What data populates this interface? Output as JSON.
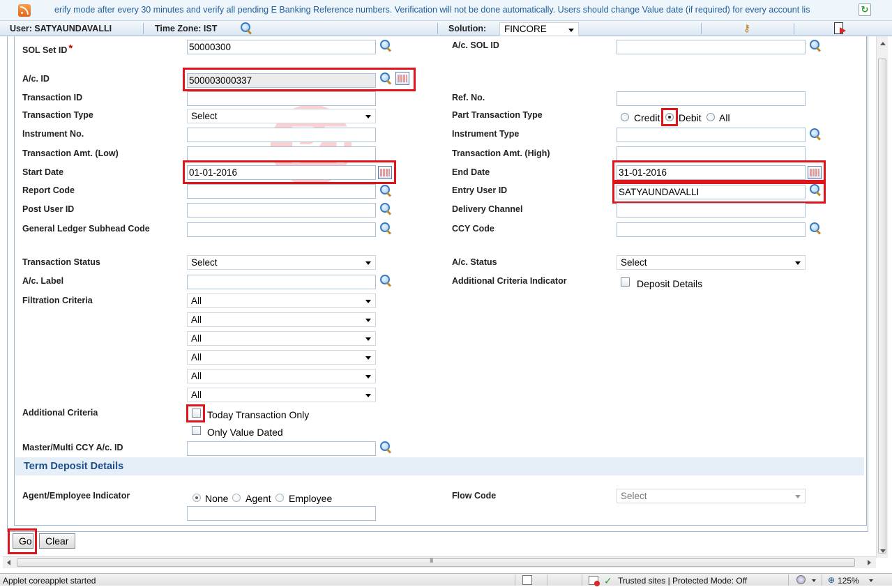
{
  "ticker": {
    "text": "erify mode after every 30 minutes and verify all pending E Banking Reference numbers. Verification will not be done automatically. Users should change Value date (if required) for every account lis"
  },
  "infobar": {
    "user_label": "User: SATYAUNDAVALLI",
    "timezone_label": "Time Zone:  IST",
    "solution_label": "Solution:",
    "solution_value": "FINCORE"
  },
  "form": {
    "sol_set_id": {
      "label": "SOL Set ID",
      "required_mark": "*",
      "value": "50000300"
    },
    "ac_sol_id": {
      "label": "A/c. SOL ID",
      "value": ""
    },
    "ac_id": {
      "label": "A/c. ID",
      "value": "500003000337"
    },
    "transaction_id": {
      "label": "Transaction ID",
      "value": ""
    },
    "ref_no": {
      "label": "Ref. No.",
      "value": ""
    },
    "transaction_type": {
      "label": "Transaction Type",
      "value": "Select"
    },
    "part_transaction_type": {
      "label": "Part Transaction Type",
      "options": [
        "Credit",
        "Debit",
        "All"
      ],
      "selected": "Debit"
    },
    "instrument_no": {
      "label": "Instrument No.",
      "value": ""
    },
    "instrument_type": {
      "label": "Instrument Type",
      "value": ""
    },
    "amt_low": {
      "label": "Transaction Amt. (Low)",
      "value": ""
    },
    "amt_high": {
      "label": "Transaction Amt. (High)",
      "value": ""
    },
    "start_date": {
      "label": "Start Date",
      "value": "01-01-2016"
    },
    "end_date": {
      "label": "End Date",
      "value": "31-01-2016"
    },
    "report_code": {
      "label": "Report Code",
      "value": ""
    },
    "entry_user_id": {
      "label": "Entry User ID",
      "value": "SATYAUNDAVALLI"
    },
    "post_user_id": {
      "label": "Post User ID",
      "value": ""
    },
    "delivery_channel": {
      "label": "Delivery Channel",
      "value": ""
    },
    "gl_subhead_code": {
      "label": "General Ledger Subhead Code",
      "value": ""
    },
    "ccy_code": {
      "label": "CCY Code",
      "value": ""
    },
    "transaction_status": {
      "label": "Transaction Status",
      "value": "Select"
    },
    "ac_status": {
      "label": "A/c. Status",
      "value": "Select"
    },
    "ac_label": {
      "label": "A/c. Label",
      "value": ""
    },
    "additional_criteria_indicator": {
      "label": "Additional Criteria Indicator",
      "option": "Deposit Details"
    },
    "filtration_criteria": {
      "label": "Filtration Criteria",
      "values": [
        "All",
        "All",
        "All",
        "All",
        "All",
        "All"
      ]
    },
    "additional_criteria": {
      "label": "Additional Criteria",
      "options": [
        "Today Transaction Only",
        "Only Value Dated"
      ]
    },
    "master_multi_ccy": {
      "label": "Master/Multi CCY A/c. ID",
      "value": ""
    }
  },
  "term_deposit": {
    "title": "Term Deposit Details",
    "agent_employee": {
      "label": "Agent/Employee Indicator",
      "options": [
        "None",
        "Agent",
        "Employee"
      ],
      "selected": "None"
    },
    "flow_code": {
      "label": "Flow Code",
      "value": "Select"
    }
  },
  "buttons": {
    "go": "Go",
    "clear": "Clear"
  },
  "statusbar": {
    "left_text": "Applet coreapplet started",
    "security_text": "Trusted sites | Protected Mode: Off",
    "zoom": "125%"
  },
  "colors": {
    "accent": "#1b4f8a",
    "highlight": "#e0151c"
  }
}
